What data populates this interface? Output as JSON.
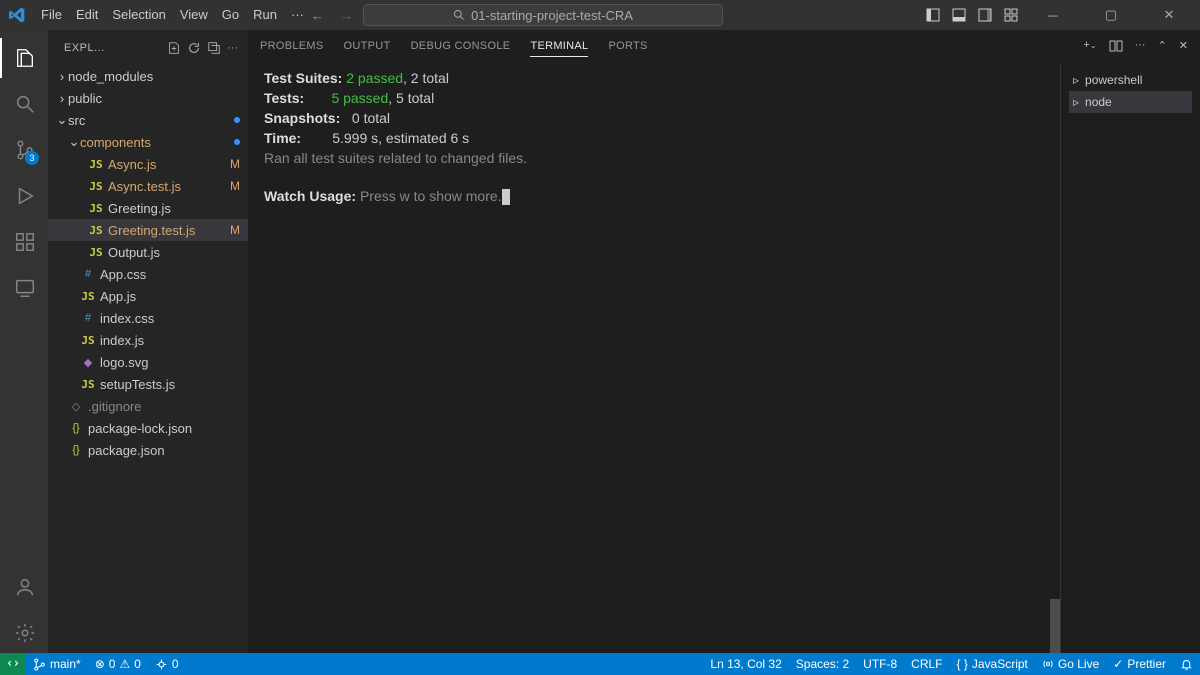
{
  "titlebar": {
    "menu": [
      "File",
      "Edit",
      "Selection",
      "View",
      "Go",
      "Run",
      "···"
    ],
    "search": "01-starting-project-test-CRA"
  },
  "activity": {
    "badge": "3"
  },
  "sidebar": {
    "title": "EXPL...",
    "folders": {
      "node_modules": "node_modules",
      "public": "public",
      "src": "src",
      "components": "components"
    },
    "files": {
      "async": "Async.js",
      "asyncTest": "Async.test.js",
      "greeting": "Greeting.js",
      "greetingTest": "Greeting.test.js",
      "output": "Output.js",
      "appcss": "App.css",
      "appjs": "App.js",
      "indexcss": "index.css",
      "indexjs": "index.js",
      "logo": "logo.svg",
      "setup": "setupTests.js",
      "gitignore": ".gitignore",
      "pkglock": "package-lock.json",
      "pkg": "package.json"
    },
    "statusM": "M"
  },
  "panelTabs": {
    "problems": "PROBLEMS",
    "output": "OUTPUT",
    "debug": "DEBUG CONSOLE",
    "terminal": "TERMINAL",
    "ports": "PORTS"
  },
  "terminal": {
    "l1a": "Test Suites: ",
    "l1b": "2 passed",
    "l1c": ", 2 total",
    "l2a": "Tests:       ",
    "l2b": "5 passed",
    "l2c": ", 5 total",
    "l3a": "Snapshots:   ",
    "l3b": "0 total",
    "l4a": "Time:        ",
    "l4b": "5.999 s, estimated 6 s",
    "l5": "Ran all test suites related to changed files.",
    "l6a": "Watch Usage: ",
    "l6b": "Press w to show more."
  },
  "termside": {
    "powershell": "powershell",
    "node": "node"
  },
  "status": {
    "branch": "main*",
    "errors": "0",
    "warnings": "0",
    "ports": "0",
    "ln": "Ln 13, Col 32",
    "spaces": "Spaces: 2",
    "encoding": "UTF-8",
    "eol": "CRLF",
    "lang": "JavaScript",
    "golive": "Go Live",
    "prettier": "Prettier"
  }
}
